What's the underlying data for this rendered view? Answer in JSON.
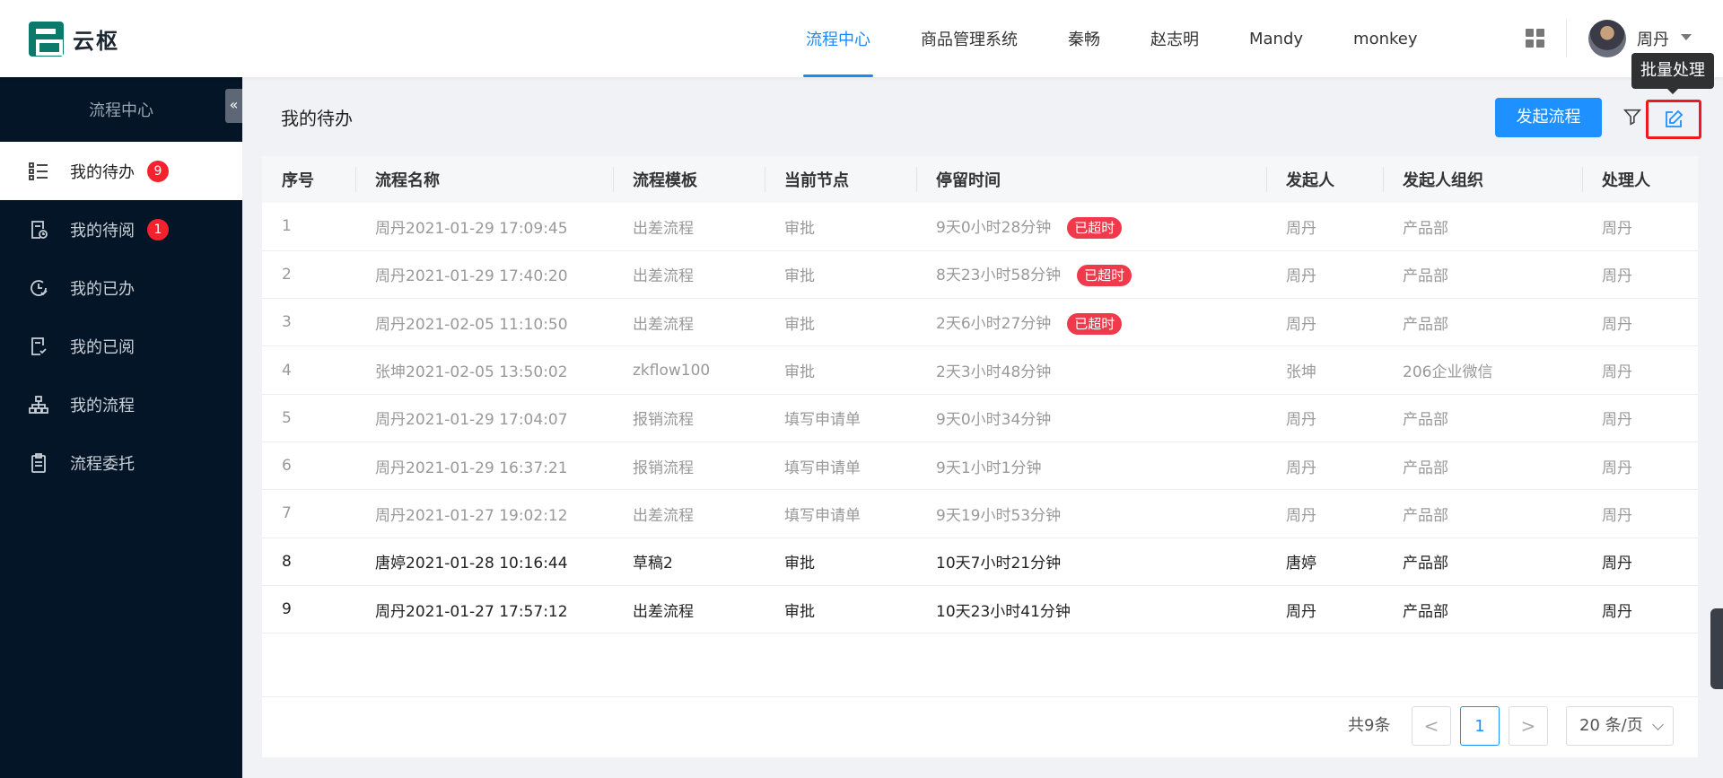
{
  "app": {
    "logo_text": "云枢"
  },
  "topnav": [
    {
      "label": "流程中心",
      "active": true
    },
    {
      "label": "商品管理系统",
      "active": false
    },
    {
      "label": "秦畅",
      "active": false
    },
    {
      "label": "赵志明",
      "active": false
    },
    {
      "label": "Mandy",
      "active": false
    },
    {
      "label": "monkey",
      "active": false
    }
  ],
  "user": {
    "name": "周丹"
  },
  "tooltip": {
    "text": "批量处理"
  },
  "sidebar": {
    "title": "流程中心",
    "collapse_glyph": "«",
    "items": [
      {
        "label": "我的待办",
        "badge": "9",
        "icon": "list-icon",
        "active": true
      },
      {
        "label": "我的待阅",
        "badge": "1",
        "icon": "doc-clock-icon",
        "active": false
      },
      {
        "label": "我的已办",
        "badge": "",
        "icon": "clock-check-icon",
        "active": false
      },
      {
        "label": "我的已阅",
        "badge": "",
        "icon": "doc-check-icon",
        "active": false
      },
      {
        "label": "我的流程",
        "badge": "",
        "icon": "org-chart-icon",
        "active": false
      },
      {
        "label": "流程委托",
        "badge": "",
        "icon": "clipboard-icon",
        "active": false
      }
    ]
  },
  "main": {
    "title": "我的待办",
    "start_button": "发起流程"
  },
  "table": {
    "headers": [
      "序号",
      "流程名称",
      "流程模板",
      "当前节点",
      "停留时间",
      "发起人",
      "发起人组织",
      "处理人"
    ],
    "overdue_label": "已超时",
    "rows": [
      {
        "no": "1",
        "name": "周丹2021-01-29 17:09:45",
        "template": "出差流程",
        "node": "审批",
        "stay": "9天0小时28分钟",
        "overdue": true,
        "initiator": "周丹",
        "org": "产品部",
        "handler": "周丹",
        "bold": false
      },
      {
        "no": "2",
        "name": "周丹2021-01-29 17:40:20",
        "template": "出差流程",
        "node": "审批",
        "stay": "8天23小时58分钟",
        "overdue": true,
        "initiator": "周丹",
        "org": "产品部",
        "handler": "周丹",
        "bold": false
      },
      {
        "no": "3",
        "name": "周丹2021-02-05 11:10:50",
        "template": "出差流程",
        "node": "审批",
        "stay": "2天6小时27分钟",
        "overdue": true,
        "initiator": "周丹",
        "org": "产品部",
        "handler": "周丹",
        "bold": false
      },
      {
        "no": "4",
        "name": "张坤2021-02-05 13:50:02",
        "template": "zkflow100",
        "node": "审批",
        "stay": "2天3小时48分钟",
        "overdue": false,
        "initiator": "张坤",
        "org": "206企业微信",
        "handler": "周丹",
        "bold": false
      },
      {
        "no": "5",
        "name": "周丹2021-01-29 17:04:07",
        "template": "报销流程",
        "node": "填写申请单",
        "stay": "9天0小时34分钟",
        "overdue": false,
        "initiator": "周丹",
        "org": "产品部",
        "handler": "周丹",
        "bold": false
      },
      {
        "no": "6",
        "name": "周丹2021-01-29 16:37:21",
        "template": "报销流程",
        "node": "填写申请单",
        "stay": "9天1小时1分钟",
        "overdue": false,
        "initiator": "周丹",
        "org": "产品部",
        "handler": "周丹",
        "bold": false
      },
      {
        "no": "7",
        "name": "周丹2021-01-27 19:02:12",
        "template": "出差流程",
        "node": "填写申请单",
        "stay": "9天19小时53分钟",
        "overdue": false,
        "initiator": "周丹",
        "org": "产品部",
        "handler": "周丹",
        "bold": false
      },
      {
        "no": "8",
        "name": "唐婷2021-01-28 10:16:44",
        "template": "草稿2",
        "node": "审批",
        "stay": "10天7小时21分钟",
        "overdue": false,
        "initiator": "唐婷",
        "org": "产品部",
        "handler": "周丹",
        "bold": true
      },
      {
        "no": "9",
        "name": "周丹2021-01-27 17:57:12",
        "template": "出差流程",
        "node": "审批",
        "stay": "10天23小时41分钟",
        "overdue": false,
        "initiator": "周丹",
        "org": "产品部",
        "handler": "周丹",
        "bold": true
      }
    ]
  },
  "pagination": {
    "total_text": "共9条",
    "prev": "<",
    "current_page": "1",
    "next": ">",
    "page_size": "20 条/页"
  },
  "colors": {
    "primary": "#1e90ff",
    "sidebar_bg": "#041527",
    "danger": "#f0394a"
  }
}
